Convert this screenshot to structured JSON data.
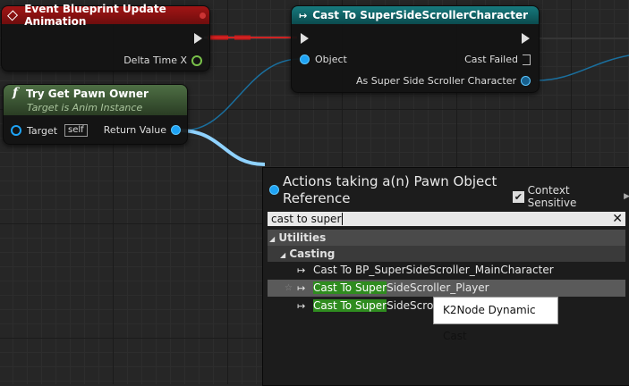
{
  "colors": {
    "event_header": "#8a1111",
    "cast_header": "#0f5c5f",
    "function_header": "#3c5a32",
    "object_pin": "#1ea3f5",
    "exec_wire": "#ffffff",
    "search_highlight": "#2f8c1f"
  },
  "event_node": {
    "title": "Event Blueprint Update Animation",
    "icon": "diamond-event-icon",
    "pin_label": "Delta Time X"
  },
  "cast_node": {
    "title": "Cast To SuperSideScrollerCharacter",
    "icon": "cast-arrow-icon",
    "object_label": "Object",
    "cast_failed_label": "Cast Failed",
    "as_label": "As Super Side Scroller Character"
  },
  "pawn_node": {
    "title": "Try Get Pawn Owner",
    "icon": "function-icon",
    "subtitle": "Target is Anim Instance",
    "target_label": "Target",
    "target_value": "self",
    "return_label": "Return Value"
  },
  "action_menu": {
    "title": "Actions taking a(n) Pawn Object Reference",
    "context_sensitive_label": "Context Sensitive",
    "context_sensitive_checked": true,
    "search_value": "cast to super",
    "categories": [
      "Utilities",
      "Casting"
    ],
    "items": [
      {
        "label": "Cast To BP_SuperSideScroller_MainCharacter"
      },
      {
        "label_hl": "Cast To Super",
        "label_rest": "SideScroller_Player"
      },
      {
        "label_hl": "Cast To Super",
        "label_rest": "SideScro"
      }
    ],
    "tooltip": "K2Node Dynamic Cast"
  }
}
